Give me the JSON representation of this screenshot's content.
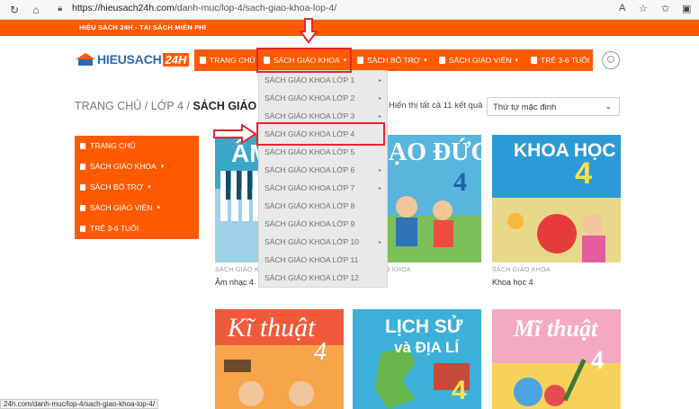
{
  "browser": {
    "url_host": "https://hieusach24h.com",
    "url_path": "/danh-muc/lop-4/sach-giao-khoa-lop-4/",
    "reader_label": "A"
  },
  "topbar": {
    "tagline": "HIỆU SÁCH 24H - TẢI SÁCH MIỄN PHÍ"
  },
  "logo": {
    "text_main": "HIEUSACH",
    "text_badge": "24H"
  },
  "mainnav": {
    "items": [
      {
        "label": "TRANG CHỦ",
        "has_caret": false
      },
      {
        "label": "SÁCH GIÁO KHOA",
        "has_caret": true
      },
      {
        "label": "SÁCH BỔ TRỢ",
        "has_caret": true
      },
      {
        "label": "SÁCH GIÁO VIÊN",
        "has_caret": true
      },
      {
        "label": "TRẺ 3-6 TUỔI",
        "has_caret": false
      }
    ]
  },
  "breadcrumb": {
    "home": "TRANG CHỦ",
    "sep": "/",
    "level": "LỚP 4",
    "current": "SÁCH GIÁO KH"
  },
  "results_text": "Hiển thị tất cả 11 kết quả",
  "sort": {
    "selected": "Thứ tự mặc định"
  },
  "sidemenu": {
    "items": [
      {
        "label": "TRANG CHỦ"
      },
      {
        "label": "SÁCH GIÁO KHOA"
      },
      {
        "label": "SÁCH BỔ TRỢ"
      },
      {
        "label": "SÁCH GIÁO VIÊN"
      },
      {
        "label": "TRẺ 3-6 TUỔI"
      }
    ]
  },
  "dropdown": {
    "items": [
      {
        "label": "SÁCH GIÁO KHOA LỚP 1",
        "has_sub": true
      },
      {
        "label": "SÁCH GIÁO KHOA LỚP 2",
        "has_sub": true
      },
      {
        "label": "SÁCH GIÁO KHOA LỚP 3",
        "has_sub": true
      },
      {
        "label": "SÁCH GIÁO KHOA LỚP 4",
        "has_sub": false,
        "highlighted": true
      },
      {
        "label": "SÁCH GIÁO KHOA LỚP 5",
        "has_sub": false
      },
      {
        "label": "SÁCH GIÁO KHOA LỚP 6",
        "has_sub": true
      },
      {
        "label": "SÁCH GIÁO KHOA LỚP 7",
        "has_sub": true
      },
      {
        "label": "SÁCH GIÁO KHOA LỚP 8",
        "has_sub": false
      },
      {
        "label": "SÁCH GIÁO KHOA LỚP 9",
        "has_sub": false
      },
      {
        "label": "SÁCH GIÁO KHOA LỚP 10",
        "has_sub": true
      },
      {
        "label": "SÁCH GIÁO KHOA LỚP 11",
        "has_sub": false
      },
      {
        "label": "SÁCH GIÁO KHOA LỚP 12",
        "has_sub": false
      }
    ]
  },
  "products": [
    {
      "category": "SÁCH GIÁO KHOA",
      "title": "Âm nhạc 4",
      "cover_text": "ÂM"
    },
    {
      "category": "SÁCH GIÁO KHOA",
      "title": "",
      "cover_text": "ẠO ĐỨC",
      "cover_num": "4"
    },
    {
      "category": "SÁCH GIÁO KHOA",
      "title": "Khoa học 4",
      "cover_text": "KHOA HỌC",
      "cover_num": "4"
    },
    {
      "cover_text": "Kĩ thuật",
      "cover_num": "4"
    },
    {
      "cover_text": "LỊCH SỬ",
      "cover_text2": "và ĐỊA LÍ",
      "cover_num": "4"
    },
    {
      "cover_text": "Mĩ thuật",
      "cover_num": "4"
    }
  ],
  "status_url": "24h.com/danh-muc/lop-4/sach-giao-khoa-lop-4/",
  "colors": {
    "brand_orange": "#ff5a00",
    "logo_blue": "#2d6aa9",
    "annotation_red": "#e5262c"
  }
}
